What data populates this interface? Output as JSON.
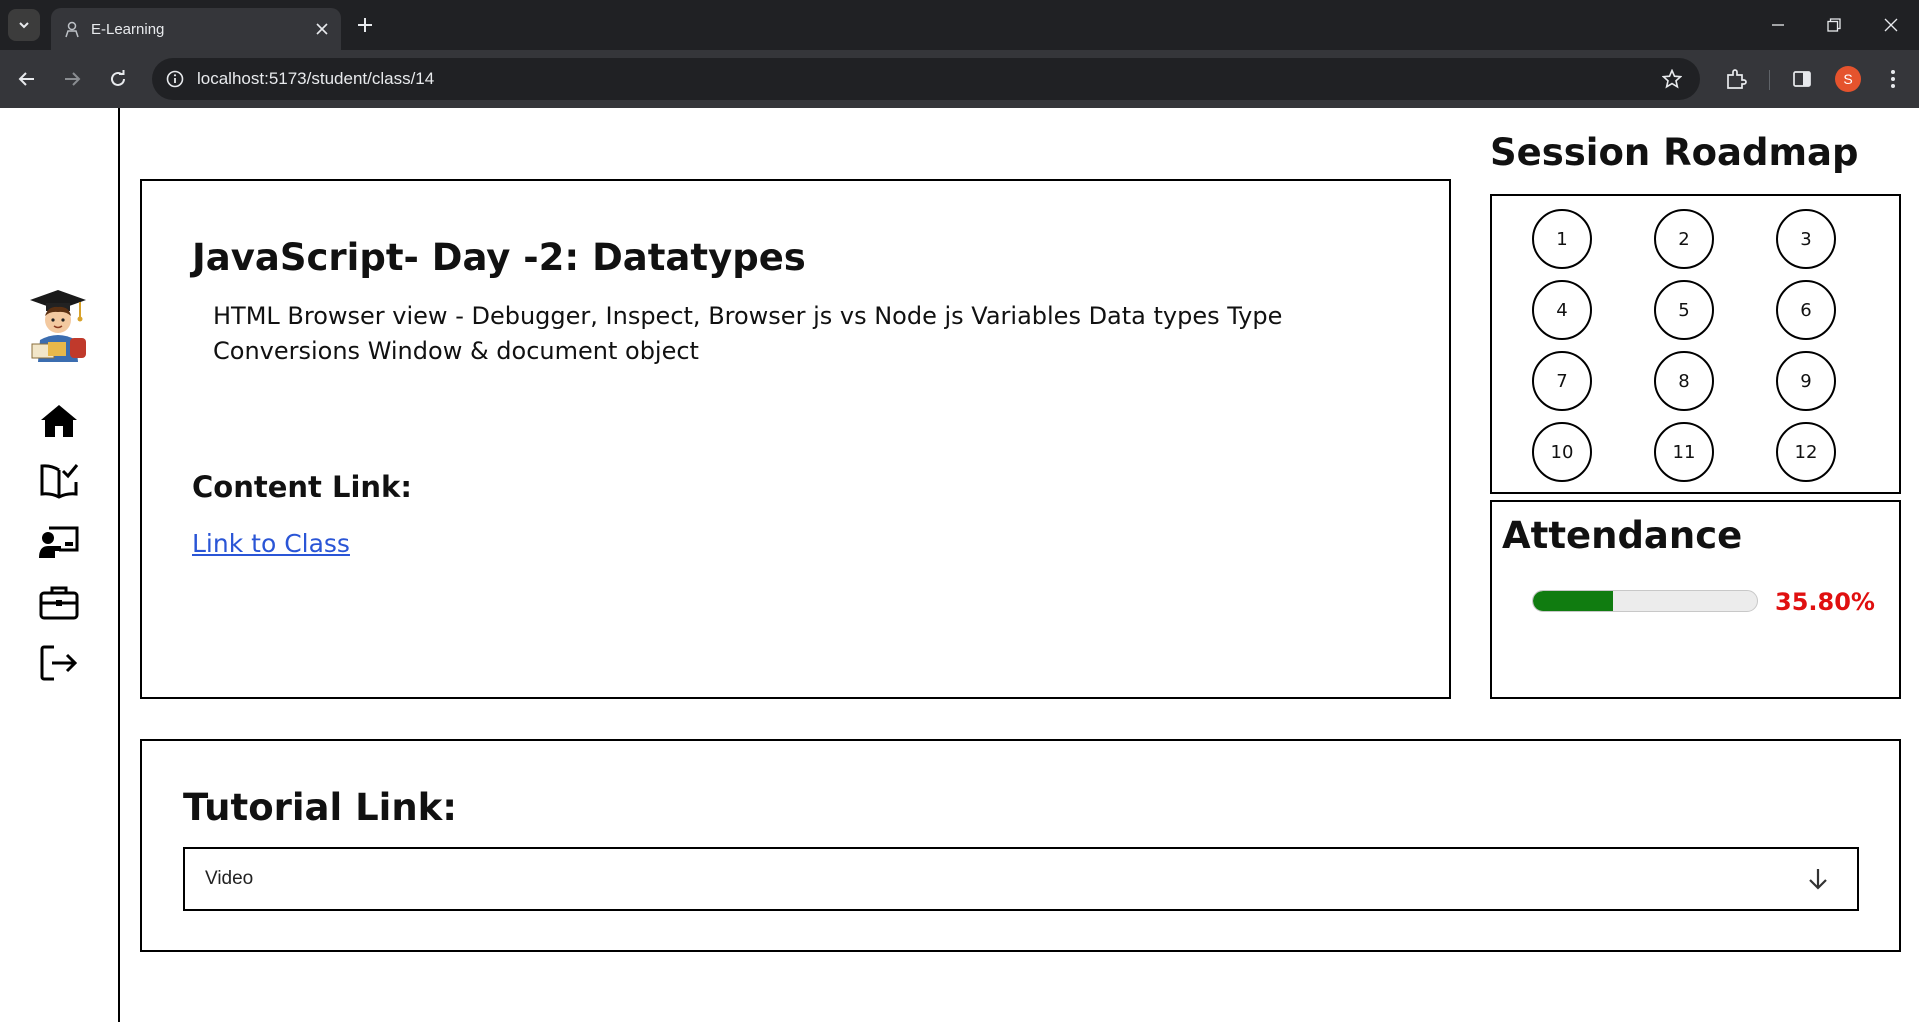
{
  "browser": {
    "tab_title": "E-Learning",
    "url": "localhost:5173/student/class/14",
    "profile_initial": "S"
  },
  "sidebar": {
    "items": [
      {
        "name": "home-icon"
      },
      {
        "name": "book-check-icon"
      },
      {
        "name": "teacher-presentation-icon"
      },
      {
        "name": "briefcase-icon"
      },
      {
        "name": "logout-icon"
      }
    ]
  },
  "class": {
    "title": "JavaScript- Day -2: Datatypes",
    "description": "HTML Browser view - Debugger, Inspect, Browser js vs Node js Variables Data types Type Conversions Window & document object",
    "content_label": "Content Link:",
    "link_text": "Link to Class"
  },
  "roadmap": {
    "title": "Session Roadmap",
    "sessions": [
      "1",
      "2",
      "3",
      "4",
      "5",
      "6",
      "7",
      "8",
      "9",
      "10",
      "11",
      "12"
    ]
  },
  "attendance": {
    "title": "Attendance",
    "percent_text": "35.80%",
    "fraction": 0.358,
    "bar_color": "#107c10",
    "text_color": "#e01010"
  },
  "tutorial": {
    "label": "Tutorial Link:",
    "selected": "Video"
  }
}
